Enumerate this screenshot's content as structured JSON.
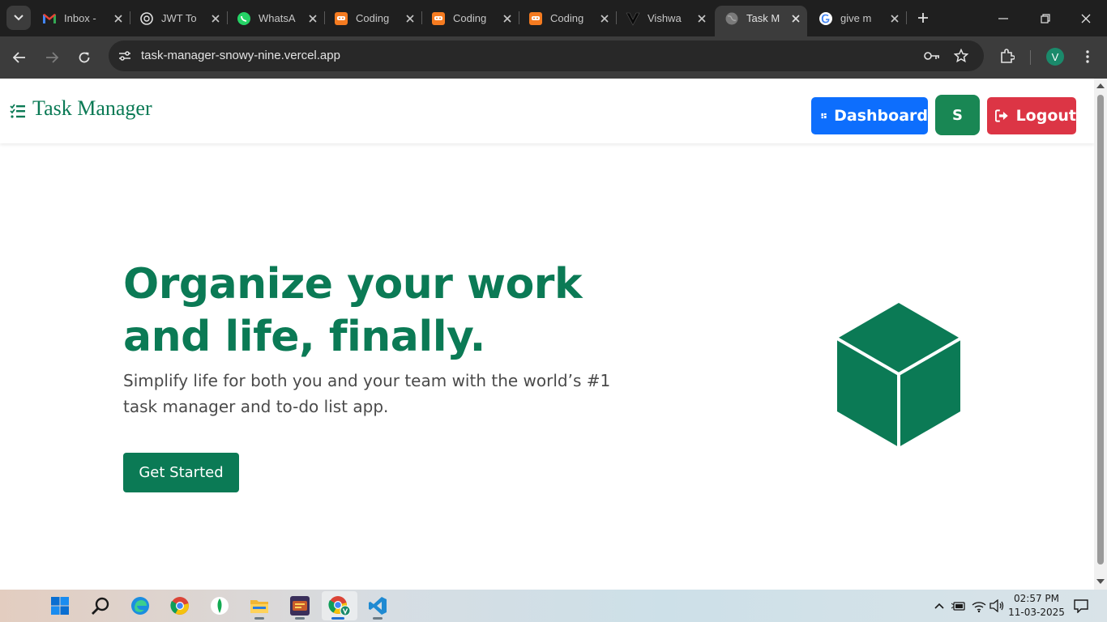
{
  "browser": {
    "tabs": [
      {
        "title": "Inbox -",
        "favicon": "gmail-icon"
      },
      {
        "title": "JWT To",
        "favicon": "openai-icon"
      },
      {
        "title": "WhatsA",
        "favicon": "whatsapp-icon"
      },
      {
        "title": "Coding",
        "favicon": "coding-ninjas-icon"
      },
      {
        "title": "Coding",
        "favicon": "coding-ninjas-icon"
      },
      {
        "title": "Coding",
        "favicon": "coding-ninjas-icon"
      },
      {
        "title": "Vishwa",
        "favicon": "vercel-v-icon"
      },
      {
        "title": "Task M",
        "favicon": "globe-icon",
        "active": true
      },
      {
        "title": "give m",
        "favicon": "google-icon"
      }
    ],
    "url": "task-manager-snowy-nine.vercel.app",
    "profile_initial": "V"
  },
  "app": {
    "brand": "Task Manager",
    "nav": {
      "dashboard_label": "Dashboard",
      "user_initial": "S",
      "logout_label": "Logout"
    },
    "hero": {
      "title": "Organize your work and life, finally.",
      "subtitle": "Simplify life for both you and your team with the world’s #1 task manager and to-do list app.",
      "cta_label": "Get Started"
    },
    "colors": {
      "brand_green": "#0b7a55",
      "dashboard_blue": "#0d6efd",
      "user_green": "#198754",
      "logout_red": "#dc3545"
    }
  },
  "taskbar": {
    "apps": [
      "windows-start-icon",
      "search-icon",
      "edge-icon",
      "chrome-icon",
      "mongodb-compass-icon",
      "file-explorer-icon",
      "game-icon",
      "chrome-profile-icon",
      "vscode-icon"
    ],
    "time": "02:57 PM",
    "date": "11-03-2025"
  }
}
